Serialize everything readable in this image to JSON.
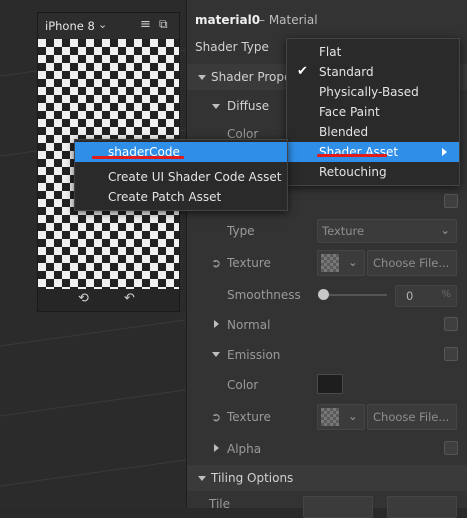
{
  "simulator": {
    "device": "iPhone 8"
  },
  "inspector": {
    "title": "material0",
    "subtitle": "– Material",
    "shader_type_label": "Shader Type",
    "shader_properties": "Shader Properti",
    "diffuse": "Diffuse",
    "color_partial": "Color",
    "type_label": "Type",
    "type_value": "Texture",
    "texture_label": "Texture",
    "choose_file": "Choose File...",
    "smoothness_label": "Smoothness",
    "smoothness_value": "0",
    "smoothness_unit": "%",
    "normal": "Normal",
    "emission": "Emission",
    "color_label": "Color",
    "texture2_label": "Texture",
    "choose_file2": "Choose File...",
    "alpha": "Alpha",
    "tiling_options": "Tiling Options",
    "tile_partial": "Tile",
    "emission_color": "#1e1e1e"
  },
  "shader_menu": {
    "items": [
      "Flat",
      "Standard",
      "Physically-Based",
      "Face Paint",
      "Blended",
      "Shader Asset",
      "Retouching"
    ],
    "checked": "Standard",
    "highlighted": "Shader Asset",
    "highlight_color": "#2f8fe8"
  },
  "context_menu": {
    "items": [
      "shaderCode",
      "Create UI Shader Code Asset",
      "Create Patch Asset"
    ],
    "highlighted": "shaderCode"
  },
  "annotation_color": "#e21b1b"
}
